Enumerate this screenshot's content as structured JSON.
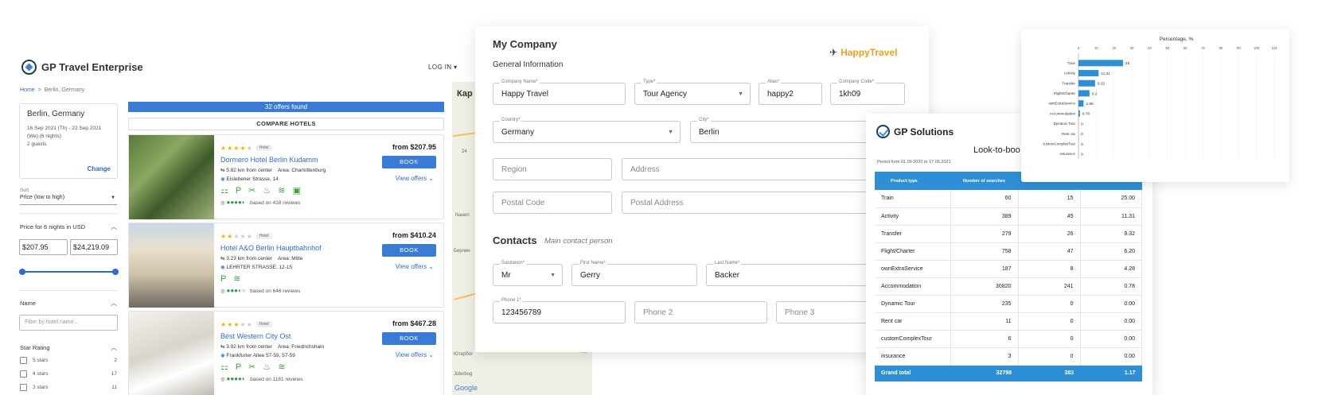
{
  "travel": {
    "brand": "GP Travel Enterprise",
    "login": "LOG IN ▾",
    "breadcrumb": {
      "home": "Home",
      "sep": ">",
      "current": "Berlin, Germany"
    },
    "search": {
      "city": "Berlin, Germany",
      "dates": "16 Sep 2021 (Th) - 22 Sep 2021",
      "nights": "(We) (6 nights)",
      "guests": "2 guests",
      "change": "Change"
    },
    "sort": {
      "label": "Sort",
      "value": "Price (low to high)"
    },
    "price_filter": {
      "title": "Price for 6 nights in USD",
      "min": "$207.95",
      "max": "$24,219.09",
      "min_fraction": 0.0,
      "max_fraction": 1.0
    },
    "name_filter": {
      "title": "Name",
      "placeholder": "Filter by hotel name..."
    },
    "star_filter": {
      "title": "Star Rating",
      "options": [
        {
          "label": "5 stars",
          "count": "2"
        },
        {
          "label": "4 stars",
          "count": "17"
        },
        {
          "label": "3 stars",
          "count": "11"
        }
      ]
    },
    "offers_found": "32 offers found",
    "compare": "COMPARE HOTELS",
    "book_label": "BOOK",
    "view_offers": "View offers",
    "hotels": [
      {
        "stars": 4,
        "tag": "Hotel",
        "name": "Dormero Hotel Berlin Kudamm",
        "distance": "5.82 km from center",
        "area": "Area: Charlottenburg",
        "address": "Eislebener Strasse, 14",
        "amenities": "⚏ P ✂ ♨ ≋ ▣",
        "rating": 4.5,
        "reviews": "based on 418 reviews",
        "price": "from $207.95",
        "img": "garden"
      },
      {
        "stars": 2,
        "tag": "Hotel",
        "name": "Hotel A&O Berlin Hauptbahnhof",
        "distance": "3.23 km from center",
        "area": "Area: Mitte",
        "address": "LEHRTER STRASSE, 12-15",
        "amenities": "P ≋",
        "rating": 3.5,
        "reviews": "based on 646 reviews",
        "price": "from $410.24",
        "img": "building"
      },
      {
        "stars": 3,
        "tag": "Hotel",
        "name": "Best Western City Ost",
        "distance": "3.92 km from center",
        "area": "Area: Friedrichshain",
        "address": "Frankfurter Allee 57-59, 57-59",
        "amenities": "⚏ P ✂ ♨ ≋",
        "rating": 4.5,
        "reviews": "based on 1181 reviews",
        "price": "from $467.28",
        "img": "bath"
      }
    ],
    "map": {
      "tab": "Кар",
      "labels": [
        "Nauen",
        "24",
        "Берлин",
        "Ютербог",
        "Jüterbog",
        "Google"
      ]
    }
  },
  "company": {
    "title": "My Company",
    "section": "General Information",
    "logo_text": "HappyTravel",
    "fields": {
      "company_name": {
        "label": "Company Name*",
        "value": "Happy Travel"
      },
      "type": {
        "label": "Type*",
        "value": "Tour Agency"
      },
      "alias": {
        "label": "Alias*",
        "value": "happy2"
      },
      "company_code": {
        "label": "Company Code*",
        "value": "1kh09"
      },
      "country": {
        "label": "Country*",
        "value": "Germany"
      },
      "city": {
        "label": "City*",
        "value": "Berlin"
      },
      "region": {
        "placeholder": "Region"
      },
      "address": {
        "placeholder": "Address"
      },
      "postal_code": {
        "placeholder": "Postal Code"
      },
      "postal_address": {
        "placeholder": "Postal Address"
      }
    },
    "contacts": {
      "title": "Contacts",
      "subtitle": "Main contact person",
      "salutation": {
        "label": "Salutation*",
        "value": "Mr"
      },
      "first_name": {
        "label": "First Name*",
        "value": "Gerry"
      },
      "last_name": {
        "label": "Last Name*",
        "value": "Backer"
      },
      "phone1": {
        "label": "Phone 1*",
        "value": "123456789"
      },
      "phone2": {
        "placeholder": "Phone 2"
      },
      "phone3": {
        "placeholder": "Phone 3"
      }
    }
  },
  "gp": {
    "brand": "GP Solutions",
    "report_title": "Look-to-boo",
    "period": "Period from 01.09.2020 to 17.05.2021",
    "columns": [
      "Product type",
      "Number of searches",
      "",
      ""
    ],
    "rows": [
      [
        "Train",
        "60",
        "15",
        "25.00"
      ],
      [
        "Activity",
        "389",
        "45",
        "11.31"
      ],
      [
        "Transfer",
        "279",
        "26",
        "9.32"
      ],
      [
        "Flight/Charter",
        "758",
        "47",
        "6.20"
      ],
      [
        "ownExtraService",
        "187",
        "8",
        "4.28"
      ],
      [
        "Accommodation",
        "30820",
        "241",
        "0.78"
      ],
      [
        "Dynamic Tour",
        "235",
        "0",
        "0.00"
      ],
      [
        "Rent car",
        "11",
        "0",
        "0.00"
      ],
      [
        "customComplexTour",
        "6",
        "0",
        "0.00"
      ],
      [
        "insurance",
        "3",
        "0",
        "0.00"
      ]
    ],
    "total": [
      "Grand total",
      "32798",
      "383",
      "1.17"
    ]
  },
  "chart_data": {
    "type": "bar",
    "orientation": "horizontal",
    "title": "Percentage, %",
    "categories": [
      "Train",
      "Activity",
      "Transfer",
      "Flight/Charter",
      "ownExtraService",
      "Accommodation",
      "Dynamic Tour",
      "Rent car",
      "customComplexTour",
      "insurance"
    ],
    "values": [
      25,
      11.31,
      9.32,
      6.2,
      2.86,
      0.78,
      0,
      0,
      0,
      0
    ],
    "value_labels": [
      "25",
      "11.31",
      "9.32",
      "6.2",
      "2.86",
      "0.78",
      "0",
      "0",
      "0",
      "0"
    ],
    "xticks": [
      0,
      10,
      20,
      30,
      40,
      50,
      60,
      70,
      80,
      90,
      100,
      110
    ],
    "xlim": [
      0,
      110
    ],
    "color": "#2f8fd6"
  }
}
